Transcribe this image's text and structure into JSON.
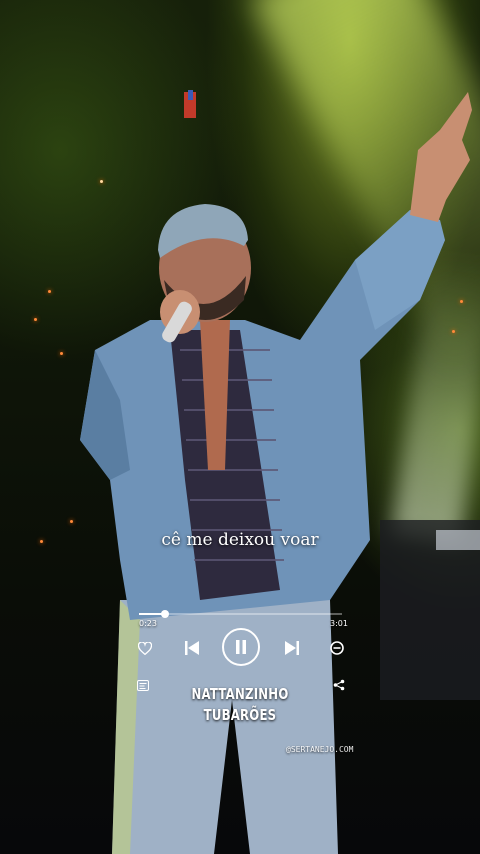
{
  "lyric": {
    "line": "cê me deixou voar"
  },
  "player": {
    "elapsed": "0:23",
    "duration": "3:01",
    "progress_fraction": 0.13,
    "state": "playing",
    "controls": {
      "like_icon": "heart-icon",
      "previous_icon": "skip-previous-icon",
      "pause_icon": "pause-icon",
      "next_icon": "skip-next-icon",
      "remove_icon": "minus-circle-icon",
      "lyrics_icon": "lyrics-icon",
      "share_icon": "share-icon"
    },
    "accent_color": "#ffffff"
  },
  "track": {
    "artist": "NATTANZINHO",
    "title": "TUBARÕES"
  },
  "watermark": {
    "handle": "@SERTANEJO.COM"
  }
}
